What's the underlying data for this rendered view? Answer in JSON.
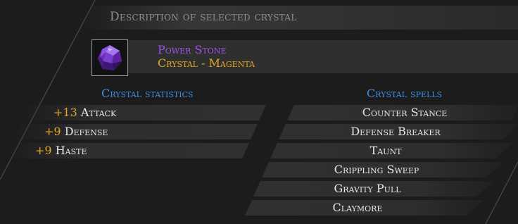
{
  "panel": {
    "heading": "Description of selected crystal"
  },
  "crystal": {
    "icon": "purple-crystal-gem-icon",
    "name": "Power Stone",
    "type": "Crystal - Magenta",
    "colors": {
      "name": "#9b55e8",
      "type": "#e3a81e"
    }
  },
  "statistics": {
    "title": "Crystal statistics",
    "items": [
      {
        "value": "+13",
        "label": "Attack"
      },
      {
        "value": "+9",
        "label": "Defense"
      },
      {
        "value": "+9",
        "label": "Haste"
      }
    ]
  },
  "spells": {
    "title": "Crystal spells",
    "items": [
      "Counter Stance",
      "Defense Breaker",
      "Taunt",
      "Crippling Sweep",
      "Gravity Pull",
      "Claymore"
    ]
  },
  "colors": {
    "accent": "#3d8fdc",
    "value": "#e3a81e",
    "text": "#e8e8e8",
    "heading": "#8e8e8e"
  }
}
